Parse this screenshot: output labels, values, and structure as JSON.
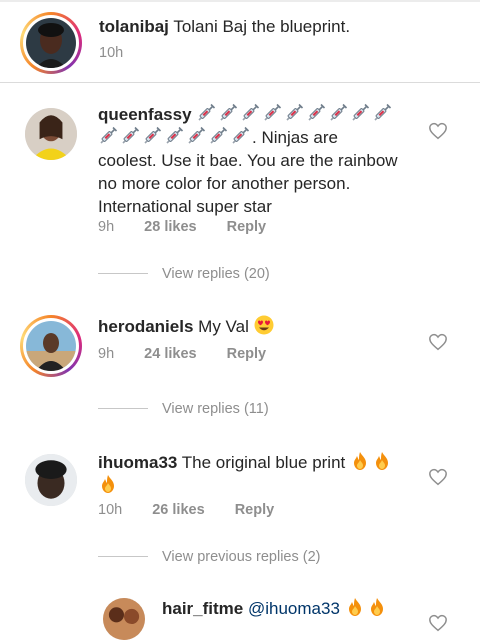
{
  "caption": {
    "username": "tolanibaj",
    "text": "Tolani Baj the blueprint.",
    "time": "10h"
  },
  "comments": [
    {
      "username": "queenfassy",
      "text_after_emoji": ". Ninjas are coolest. Use it bae. You are the rainbow no more color for another person. International super star",
      "emoji_name": "syringe-emoji",
      "emoji_count": 16,
      "time": "9h",
      "likes": "28 likes",
      "reply": "Reply",
      "view_replies": "View replies (20)"
    },
    {
      "username": "herodaniels",
      "text": "My Val",
      "emoji_name": "heart-eyes-emoji",
      "time": "9h",
      "likes": "24 likes",
      "reply": "Reply",
      "view_replies": "View replies (11)"
    },
    {
      "username": "ihuoma33",
      "text": "The original blue print",
      "emoji_name": "fire-emoji",
      "emoji_count": 3,
      "time": "10h",
      "likes": "26 likes",
      "reply": "Reply",
      "view_replies": "View previous replies (2)"
    }
  ],
  "reply_preview": {
    "username": "hair_fitme",
    "mention": "@ihuoma33",
    "emoji_name": "fire-emoji",
    "emoji_count": 2
  },
  "colors": {
    "text": "#262626",
    "meta": "#8e8e8e",
    "mention": "#003569",
    "divider": "#dbdbdb"
  }
}
